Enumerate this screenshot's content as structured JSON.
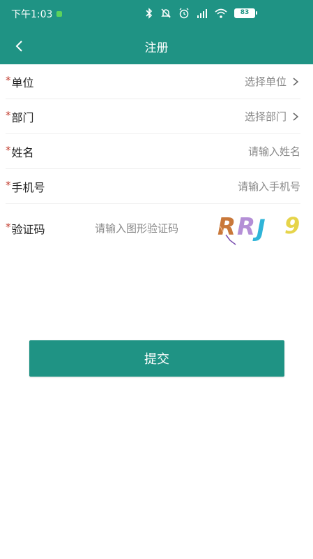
{
  "status_bar": {
    "time": "下午1:03",
    "battery": "83"
  },
  "nav": {
    "title": "注册"
  },
  "form": {
    "fields": [
      {
        "label": "单位",
        "required_mark": "*",
        "value_text": "选择单位",
        "type": "select"
      },
      {
        "label": "部门",
        "required_mark": "*",
        "value_text": "选择部门",
        "type": "select"
      },
      {
        "label": "姓名",
        "required_mark": "*",
        "placeholder": "请输入姓名",
        "type": "input"
      },
      {
        "label": "手机号",
        "required_mark": "*",
        "placeholder": "请输入手机号",
        "type": "input"
      },
      {
        "label": "验证码",
        "required_mark": "*",
        "placeholder": "请输入图形验证码",
        "type": "captcha"
      }
    ],
    "captcha_text": "RRJ 9"
  },
  "submit": {
    "label": "提交"
  },
  "colors": {
    "primary": "#1f9384",
    "required": "#c0392b"
  }
}
